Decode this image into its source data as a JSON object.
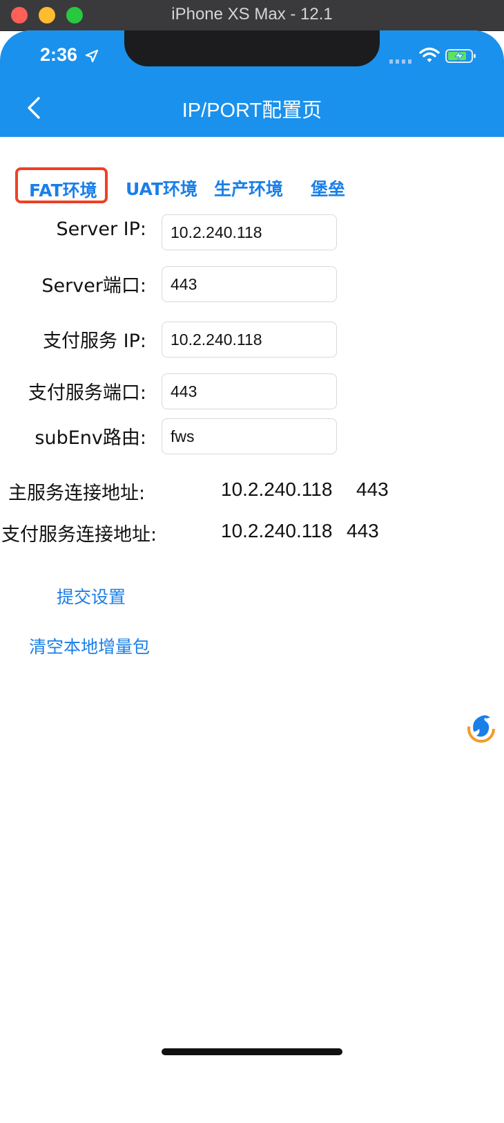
{
  "window": {
    "title": "iPhone XS Max - 12.1"
  },
  "status_bar": {
    "time": "2:36"
  },
  "nav": {
    "title": "IP/PORT配置页"
  },
  "tabs": [
    {
      "label": "FAT环境",
      "selected": true
    },
    {
      "label": "UAT环境",
      "selected": false
    },
    {
      "label": "生产环境",
      "selected": false
    },
    {
      "label": "堡垒",
      "selected": false
    }
  ],
  "form": {
    "server_ip": {
      "label": "Server IP:",
      "value": "10.2.240.118"
    },
    "server_port": {
      "label": "Server端口:",
      "value": "443"
    },
    "pay_ip": {
      "label": "支付服务 IP:",
      "value": "10.2.240.118"
    },
    "pay_port": {
      "label": "支付服务端口:",
      "value": "443"
    },
    "subenv": {
      "label": "subEnv路由:",
      "value": "fws"
    }
  },
  "connections": {
    "main": {
      "label": "主服务连接地址:",
      "ip": "10.2.240.118",
      "port": "443"
    },
    "pay": {
      "label": "支付服务连接地址:",
      "ip": "10.2.240.118",
      "port": "443"
    }
  },
  "actions": {
    "submit": "提交设置",
    "clear": "清空本地增量包"
  },
  "colors": {
    "nav_bar": "#1a91ec",
    "link": "#1a7fe8",
    "selected_tab_border": "#ee4124"
  },
  "icons": [
    "back-chevron-icon",
    "location-arrow-icon",
    "wifi-icon",
    "battery-charging-icon",
    "dolphin-logo-icon"
  ]
}
